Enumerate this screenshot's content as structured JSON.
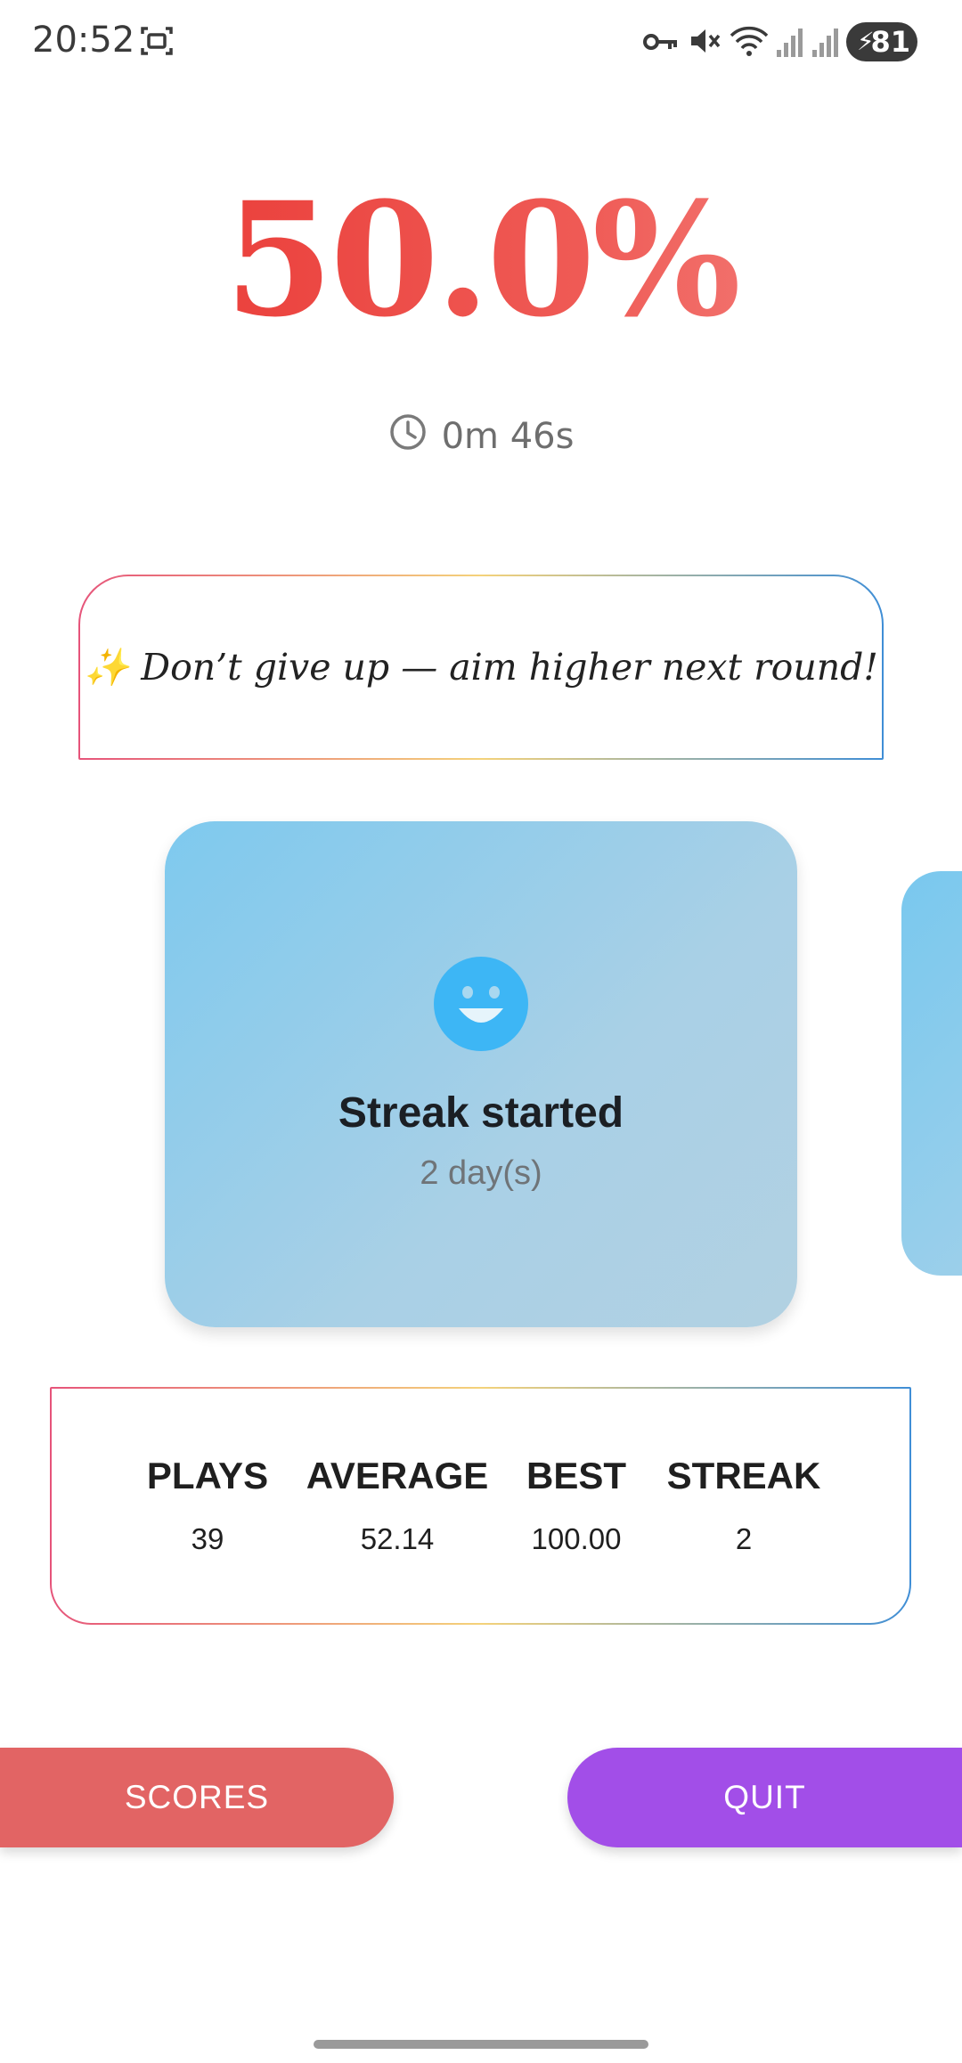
{
  "status_bar": {
    "time": "20:52",
    "battery": "81",
    "icons": [
      "screen-record-icon",
      "vpn-key-icon",
      "mute-icon",
      "wifi-icon",
      "signal-icon",
      "signal-icon",
      "charging-bolt-icon"
    ]
  },
  "result": {
    "score": "50.0%",
    "time": "0m 46s"
  },
  "message": "✨ Don’t give up — aim higher next round!",
  "achievement": {
    "icon": "smiley-icon",
    "title": "Streak started",
    "subtitle": "2 day(s)"
  },
  "stats": [
    {
      "label": "PLAYS",
      "value": "39"
    },
    {
      "label": "AVERAGE",
      "value": "52.14"
    },
    {
      "label": "BEST",
      "value": "100.00"
    },
    {
      "label": "STREAK",
      "value": "2"
    }
  ],
  "buttons": {
    "scores": "SCORES",
    "quit": "QUIT"
  },
  "colors": {
    "score_gradient_start": "#e8322e",
    "score_gradient_end": "#f58c88",
    "scores_button": "#e26464",
    "quit_button": "#a24ee8",
    "card": "#8fcbea",
    "smiley": "#3db6f5"
  }
}
